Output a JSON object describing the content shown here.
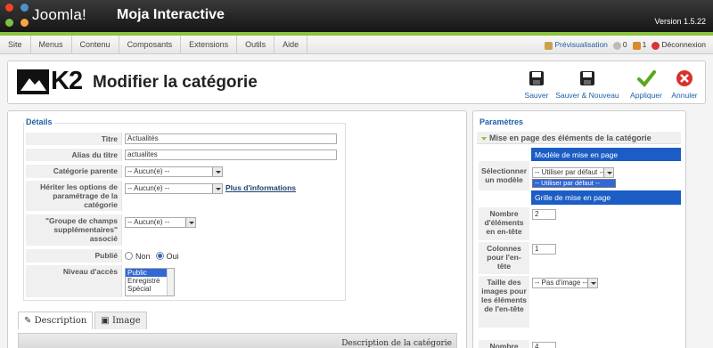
{
  "header": {
    "logo_text": "Joomla!",
    "site_name": "Moja Interactive",
    "version": "Version 1.5.22"
  },
  "menu": {
    "items": [
      "Site",
      "Menus",
      "Contenu",
      "Composants",
      "Extensions",
      "Outils",
      "Aide"
    ],
    "preview": "Prévisualisation",
    "messages_count": "0",
    "users_count": "1",
    "logout": "Déconnexion"
  },
  "toolbar": {
    "logo_text": "K2",
    "title": "Modifier la catégorie",
    "buttons": {
      "save": "Sauver",
      "save_new": "Sauver & Nouveau",
      "apply": "Appliquer",
      "cancel": "Annuler"
    }
  },
  "details": {
    "legend": "Détails",
    "title_label": "Titre",
    "title_value": "Actualités",
    "alias_label": "Alias du titre",
    "alias_value": "actualites",
    "parent_label": "Catégorie parente",
    "parent_value": "-- Aucun(e) --",
    "inherit_label": "Hériter les options de paramétrage de la catégorie",
    "inherit_value": "-- Aucun(e) --",
    "inherit_link": "Plus d'informations",
    "extra_label": "\"Groupe de champs supplémentaires\" associé",
    "extra_value": "-- Aucun(e) --",
    "published_label": "Publié",
    "published_no": "Non",
    "published_yes": "Oui",
    "access_label": "Niveau d'accès",
    "access_options": [
      "Public",
      "Enregistré",
      "Spécial"
    ]
  },
  "tabs": {
    "description": "Description",
    "image": "Image",
    "description_bar": "Description de la catégorie"
  },
  "params": {
    "legend": "Paramètres",
    "slider_title": "Mise en page des éléments de la catégorie",
    "layout_header": "Modèle de mise en page",
    "template_label": "Sélectionner un modèle",
    "template_value": "-- Utiliser par défaut --",
    "template_dropdown_option": "-- Utiliser par défaut --",
    "grid_header": "Grille de mise en page",
    "lead_count_label": "Nombre d'éléments en en-tête",
    "lead_count_value": "2",
    "lead_cols_label": "Colonnes pour l'en-tête",
    "lead_cols_value": "1",
    "lead_img_label": "Taille des images pour les éléments de l'en-tête",
    "lead_img_value": "-- Pas d'image --",
    "next_label": "Nombre",
    "next_value": "4"
  },
  "colors": {
    "accent_green": "#8bc53f",
    "link_blue": "#1e5fa8",
    "highlight_blue": "#1b5dc4"
  }
}
